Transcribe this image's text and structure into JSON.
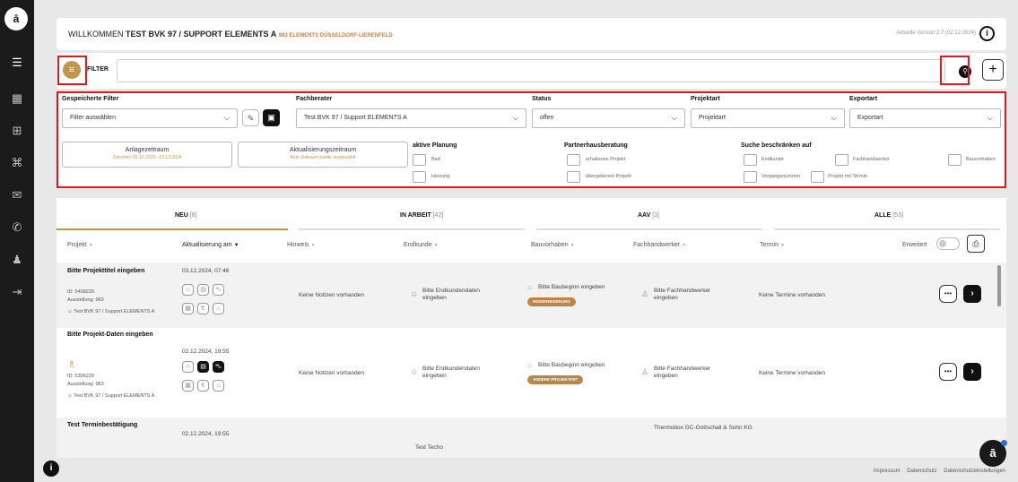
{
  "header": {
    "welcome_prefix": "WILLKOMMEN",
    "user": "TEST BVK 97 / SUPPORT ELEMENTS A",
    "location": "983 ELEMENTS DÜSSELDORF-LIERENFELD",
    "version": "Aktuelle Version 2.7 (02.12.2024)"
  },
  "filterbar": {
    "label": "FILTER",
    "search_value": ""
  },
  "filters": {
    "saved": {
      "label": "Gespeicherte Filter",
      "value": "Filter auswählen"
    },
    "advisor": {
      "label": "Fachberater",
      "value": "Test BVK 97 / Support ELEMENTS A"
    },
    "status": {
      "label": "Status",
      "value": "offen"
    },
    "projektart": {
      "label": "Projektart",
      "value": "Projektart"
    },
    "exportart": {
      "label": "Exportart",
      "value": "Exportart"
    },
    "created": {
      "label": "Anlagezeitraum",
      "range": "Zwischen 03.12.2023 - 03.12.2024"
    },
    "updated": {
      "label": "Aktualisierungszeitraum",
      "range": "Kein Zeitraum wurde ausgewählt"
    },
    "planning": {
      "title": "aktive Planung",
      "options": [
        "Bad",
        "Heizung"
      ]
    },
    "partner": {
      "title": "Partnerhausberatung",
      "options": [
        "erhaltenes Projekt",
        "übergebenes Projekt"
      ]
    },
    "restrict": {
      "title": "Suche beschränken auf",
      "options": [
        "Endkunde",
        "Fachhandwerker",
        "Bauvorhaben",
        "Vorgangsnummer",
        "Projekt mit Termin"
      ]
    }
  },
  "tabs": [
    {
      "label": "NEU",
      "count": "[8]"
    },
    {
      "label": "IN ARBEIT",
      "count": "[42]"
    },
    {
      "label": "AAV",
      "count": "[3]"
    },
    {
      "label": "ALLE",
      "count": "[53]"
    }
  ],
  "columns": {
    "projekt": "Projekt",
    "aktualisierung": "Aktualisierung am",
    "hinweis": "Hinweis",
    "endkunde": "Endkunde",
    "bauvorhaben": "Bauvorhaben",
    "fachhandwerker": "Fachhandwerker",
    "termin": "Termin",
    "erweitert": "Erweitert"
  },
  "rows": [
    {
      "title": "Bitte Projekttitel eingeben",
      "id": "ID: 5408229",
      "exhibition": "Ausstellung: 983",
      "advisor": "Test BVK 97 / Support ELEMENTS A",
      "updated": "03.12.2024, 07:46",
      "note": "Keine Notizen vorhanden",
      "customer": "Bitte Endkundendaten eingeben",
      "construction": "Bitte Baubeginn eingeben",
      "badge": "MODERNISIERUNG",
      "craftsman": "Bitte Fachhandwerker eingeben",
      "appointment": "Keine Termine vorhanden"
    },
    {
      "title": "Bitte Projekt-Daten eingeben",
      "id": "ID: 5396229",
      "exhibition": "Ausstellung: 983",
      "advisor": "Test BVK 97 / Support ELEMENTS A",
      "updated": "02.12.2024, 19:55",
      "note": "Keine Notizen vorhanden",
      "customer": "Bitte Endkundendaten eingeben",
      "construction": "Bitte Baubeginn eingeben",
      "badge": "ANDERE PROJEKTART",
      "craftsman": "Bitte Fachhandwerker eingeben",
      "appointment": "Keine Termine vorhanden"
    },
    {
      "title": "Test Terminbestätigung",
      "updated": "02.12.2024, 19:55",
      "note": "Test Techo",
      "craftsman": "Thermobox GC-Gottschall & Sohn KG"
    }
  ],
  "footer": {
    "impressum": "Impressum",
    "datenschutz": "Datenschutz",
    "einstellungen": "Datenschutzeinstellungen"
  }
}
